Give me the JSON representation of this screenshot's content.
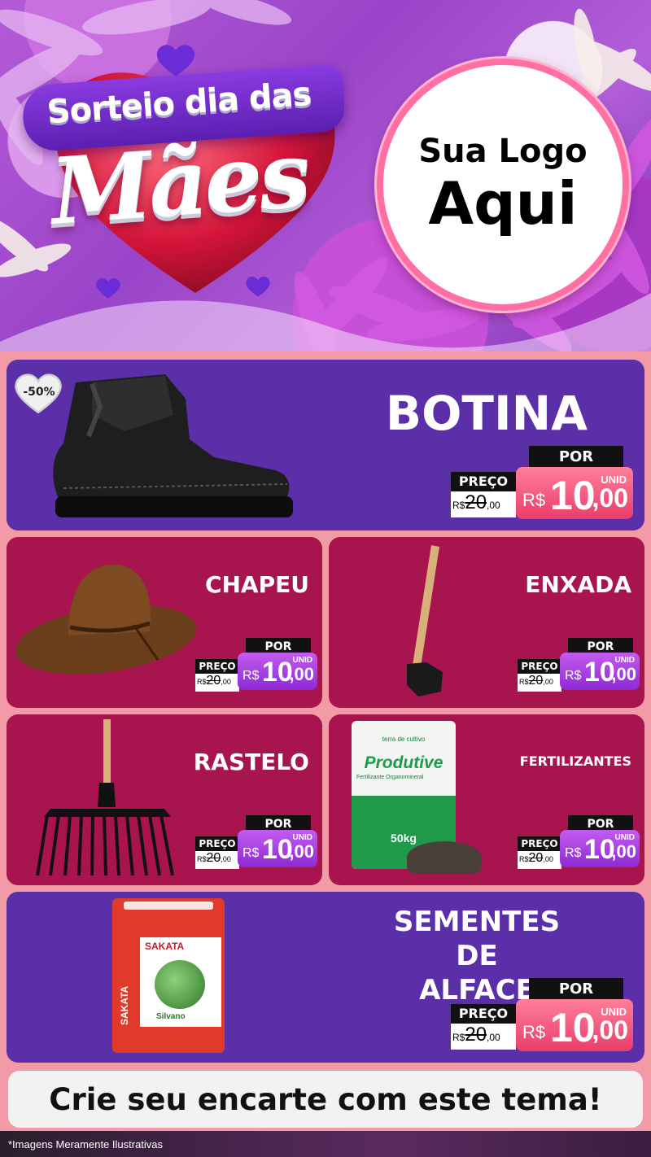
{
  "header": {
    "title_line1": "Sorteio dia das",
    "title_line2": "Mães",
    "logo_line1": "Sua Logo",
    "logo_line2": "Aqui"
  },
  "discount_badge": "-50%",
  "products": [
    {
      "name": "BOTINA",
      "old_label": "PREÇO",
      "old_currency": "R$",
      "old_price": "20",
      "old_cents": ",00",
      "por_label": "POR",
      "unit": "UNID",
      "currency": "R$",
      "price": "10",
      "cents": ",00"
    },
    {
      "name": "CHAPEU",
      "old_label": "PREÇO",
      "old_currency": "R$",
      "old_price": "20",
      "old_cents": ",00",
      "por_label": "POR",
      "unit": "UNID",
      "currency": "R$",
      "price": "10",
      "cents": ",00"
    },
    {
      "name": "ENXADA",
      "old_label": "PREÇO",
      "old_currency": "R$",
      "old_price": "20",
      "old_cents": ",00",
      "por_label": "POR",
      "unit": "UNID",
      "currency": "R$",
      "price": "10",
      "cents": ",00"
    },
    {
      "name": "RASTELO",
      "old_label": "PREÇO",
      "old_currency": "R$",
      "old_price": "20",
      "old_cents": ",00",
      "por_label": "POR",
      "unit": "UNID",
      "currency": "R$",
      "price": "10",
      "cents": ",00"
    },
    {
      "name": "FERTILIZANTES",
      "old_label": "PREÇO",
      "old_currency": "R$",
      "old_price": "20",
      "old_cents": ",00",
      "por_label": "POR",
      "unit": "UNID",
      "currency": "R$",
      "price": "10",
      "cents": ",00"
    },
    {
      "name_line1": "SEMENTES DE",
      "name_line2": "ALFACE",
      "old_label": "PREÇO",
      "old_currency": "R$",
      "old_price": "20",
      "old_cents": ",00",
      "por_label": "POR",
      "unit": "UNID",
      "currency": "R$",
      "price": "10",
      "cents": ",00"
    }
  ],
  "product_art": {
    "fertilizer_brand": "terra de cultivo",
    "fertilizer_product": "Produtive",
    "fertilizer_sub": "Fertilizante Organomineral",
    "fertilizer_weight": "50kg",
    "seed_brand": "SAKATA",
    "seed_variety": "Silvano"
  },
  "cta": "Crie seu encarte com este tema!",
  "disclaimer": "*Imagens Meramente Ilustrativas",
  "colors": {
    "header_purple": "#9a44c9",
    "card_purple": "#5b2fa8",
    "card_wine": "#a8144e",
    "background_pink": "#f29aa6",
    "price_pink": "#ea3d6b",
    "price_violet": "#8d2ad4"
  }
}
